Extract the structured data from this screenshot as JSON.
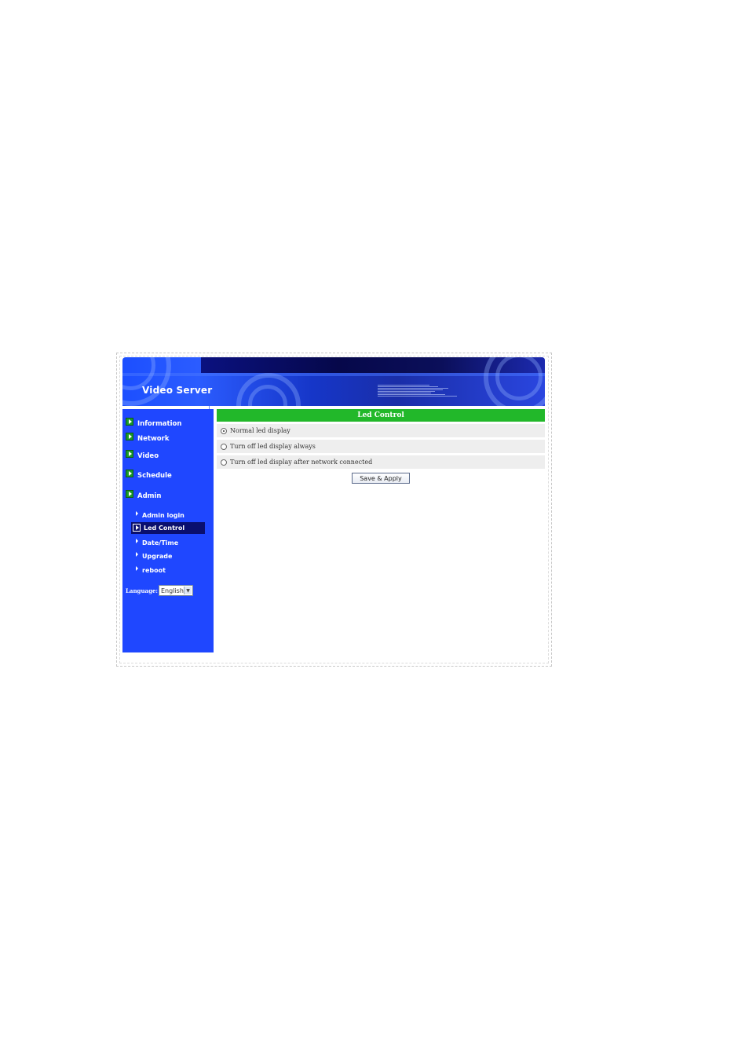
{
  "header": {
    "title": "Video Server"
  },
  "sidebar": {
    "items": [
      {
        "label": "Information"
      },
      {
        "label": "Network"
      },
      {
        "label": "Video"
      },
      {
        "label": "Schedule"
      },
      {
        "label": "Admin"
      }
    ],
    "admin_sub": [
      {
        "label": "Admin login"
      },
      {
        "label": "Led Control",
        "active": true
      },
      {
        "label": "Date/Time"
      },
      {
        "label": "Upgrade"
      },
      {
        "label": "reboot"
      }
    ],
    "language_label": "Language:",
    "language_value": "English"
  },
  "panel": {
    "title": "Led Control",
    "options": [
      {
        "label": "Normal led display",
        "checked": true
      },
      {
        "label": "Turn off led display always",
        "checked": false
      },
      {
        "label": "Turn off led display after network connected",
        "checked": false
      }
    ],
    "save_label": "Save & Apply"
  },
  "colors": {
    "sidebar_bg": "#1f47ff",
    "title_bar": "#22b82a",
    "active_item": "#0a0f6e",
    "option_row": "#eeeeee"
  },
  "icons": {
    "nav_bullet": "green-arrow-icon",
    "sub_bullet": "triangle-arrow-icon",
    "select_caret": "chevron-down-icon"
  }
}
